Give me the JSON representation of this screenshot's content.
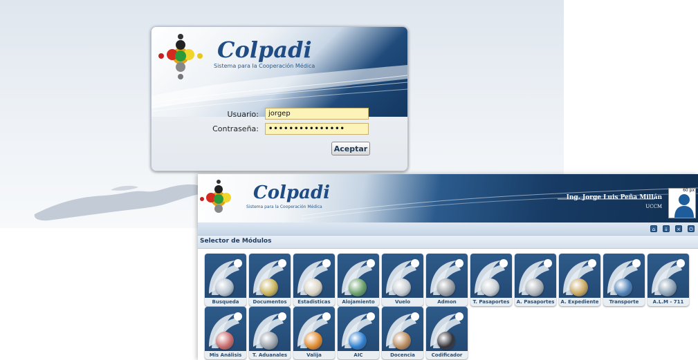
{
  "login": {
    "brand": "Colpadi",
    "tagline": "Sistema para la Cooperación Médica",
    "user_label": "Usuario:",
    "user_value": "jorgep",
    "password_label": "Contraseña:",
    "password_value": "•••••••••••••••",
    "accept_label": "Aceptar"
  },
  "app": {
    "brand": "Colpadi",
    "tagline": "Sistema para la Cooperación Médica",
    "user_name": "Ing. Jorge Luis Peña Millán",
    "user_org": "UCCM",
    "avatar_caption": "60 px",
    "section_title": "Selector de Módulos",
    "toolbar_icons": [
      "home-icon",
      "download-icon",
      "close-icon",
      "power-icon"
    ]
  },
  "modules": [
    {
      "label": "Busqueda",
      "icon": "magnifier-icon",
      "color": "#b7c3cf"
    },
    {
      "label": "Documentos",
      "icon": "documents-icon",
      "color": "#c9b25a"
    },
    {
      "label": "Estadisticas",
      "icon": "statistics-icon",
      "color": "#d9d2c2"
    },
    {
      "label": "Alojamiento",
      "icon": "accommodation-icon",
      "color": "#6aa06a"
    },
    {
      "label": "Vuelo",
      "icon": "airplane-icon",
      "color": "#c7ccd2"
    },
    {
      "label": "Admon",
      "icon": "admin-icon",
      "color": "#9a9ea3"
    },
    {
      "label": "T. Pasaportes",
      "icon": "passport-transfer-icon",
      "color": "#c9cdd2"
    },
    {
      "label": "A. Pasaportes",
      "icon": "passport-archive-icon",
      "color": "#aeb3b8"
    },
    {
      "label": "A. Expediente",
      "icon": "file-archive-icon",
      "color": "#c9a75f"
    },
    {
      "label": "Transporte",
      "icon": "bus-icon",
      "color": "#4f82b8"
    },
    {
      "label": "A.L.M - 711",
      "icon": "truck-icon",
      "color": "#8da2b5"
    },
    {
      "label": "Mis Análisis",
      "icon": "analysis-icon",
      "color": "#c96a6a"
    },
    {
      "label": "T. Aduanales",
      "icon": "customs-icon",
      "color": "#9aa2aa"
    },
    {
      "label": "Valija",
      "icon": "briefcase-icon",
      "color": "#e08a2e"
    },
    {
      "label": "AIC",
      "icon": "info-icon",
      "color": "#2f7fd0"
    },
    {
      "label": "Docencia",
      "icon": "teacher-icon",
      "color": "#b98a5c"
    },
    {
      "label": "Codificador",
      "icon": "encoder-icon",
      "color": "#34343c"
    }
  ]
}
